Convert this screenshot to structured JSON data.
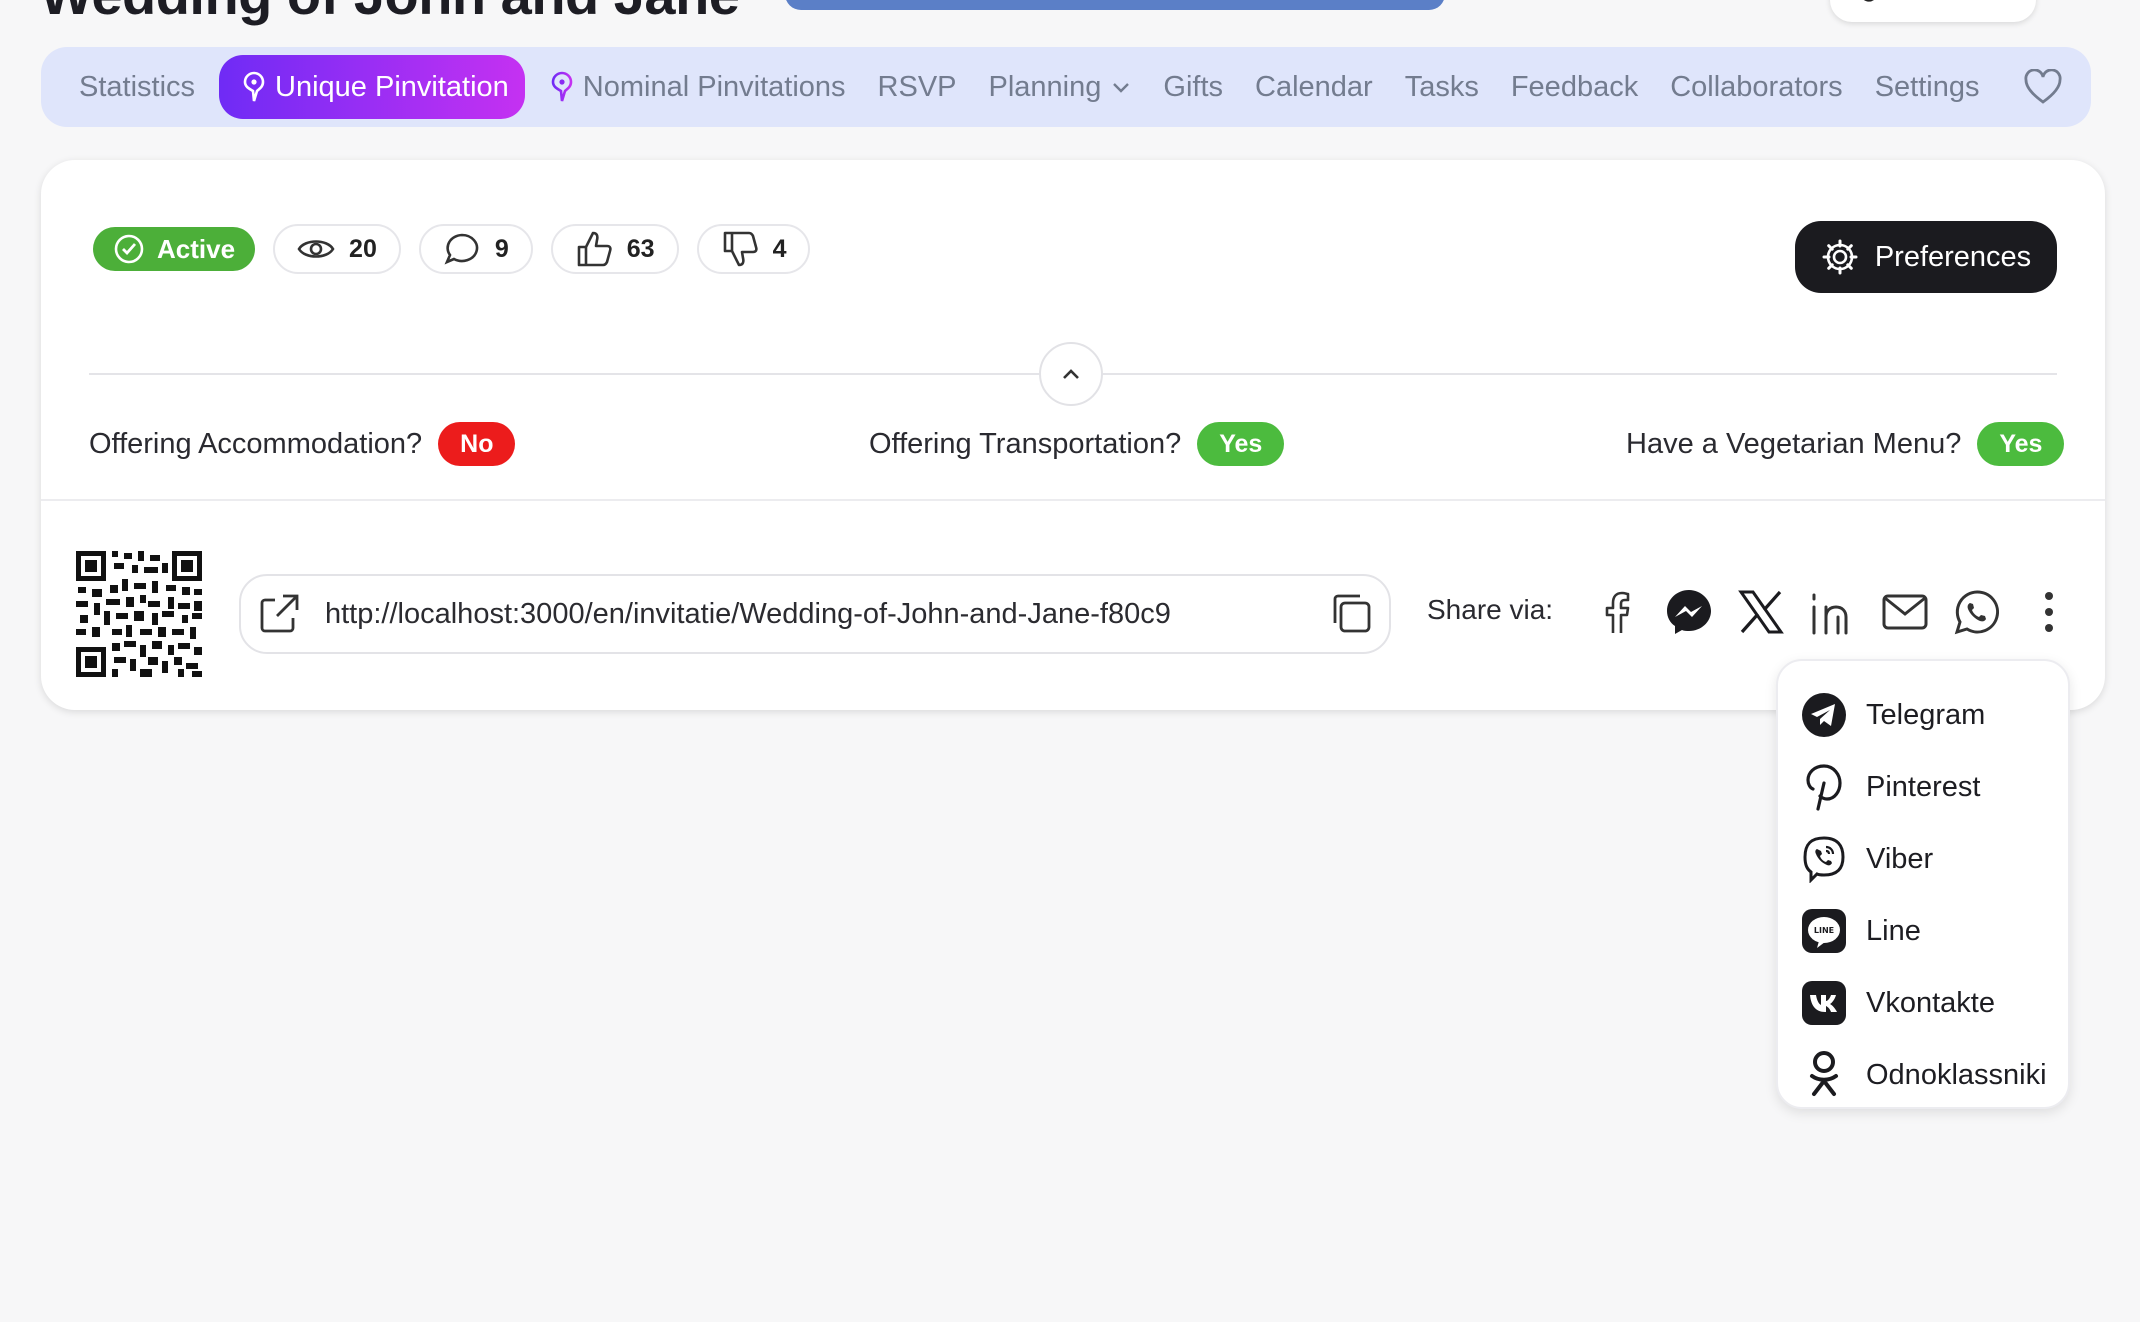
{
  "header": {
    "title": "Wedding of John and Jane"
  },
  "nav": {
    "items": [
      {
        "label": "Statistics"
      },
      {
        "label": "Unique Pinvitation",
        "active": true
      },
      {
        "label": "Nominal Pinvitations"
      },
      {
        "label": "RSVP"
      },
      {
        "label": "Planning"
      },
      {
        "label": "Gifts"
      },
      {
        "label": "Calendar"
      },
      {
        "label": "Tasks"
      },
      {
        "label": "Feedback"
      },
      {
        "label": "Collaborators"
      },
      {
        "label": "Settings"
      }
    ],
    "favorite_icon": "heart-icon",
    "active_gradient": [
      "#6f2bf5",
      "#c531f2"
    ]
  },
  "stats": {
    "status": "Active",
    "views": "20",
    "comments": "9",
    "likes": "63",
    "dislikes": "4"
  },
  "preferences_label": "Preferences",
  "options": [
    {
      "question": "Offering Accommodation?",
      "answer": "No"
    },
    {
      "question": "Offering Transportation?",
      "answer": "Yes"
    },
    {
      "question": "Have a Vegetarian Menu?",
      "answer": "Yes"
    }
  ],
  "share": {
    "url": "http://localhost:3000/en/invitatie/Wedding-of-John-and-Jane-f80c9",
    "label": "Share via:",
    "icons": [
      "facebook-icon",
      "messenger-icon",
      "x-icon",
      "linkedin-icon",
      "mail-icon",
      "whatsapp-icon",
      "more-icon"
    ]
  },
  "share_menu": {
    "items": [
      {
        "label": "Telegram",
        "icon": "telegram-icon"
      },
      {
        "label": "Pinterest",
        "icon": "pinterest-icon"
      },
      {
        "label": "Viber",
        "icon": "viber-icon"
      },
      {
        "label": "Line",
        "icon": "line-icon"
      },
      {
        "label": "Vkontakte",
        "icon": "vkontakte-icon"
      },
      {
        "label": "Odnoklassniki",
        "icon": "odnoklassniki-icon"
      }
    ]
  },
  "colors": {
    "status_active": "#4caf39",
    "tag_no": "#ec1c1c",
    "tag_yes": "#4cbb3e",
    "nav_bg": "#dfe5fb"
  }
}
